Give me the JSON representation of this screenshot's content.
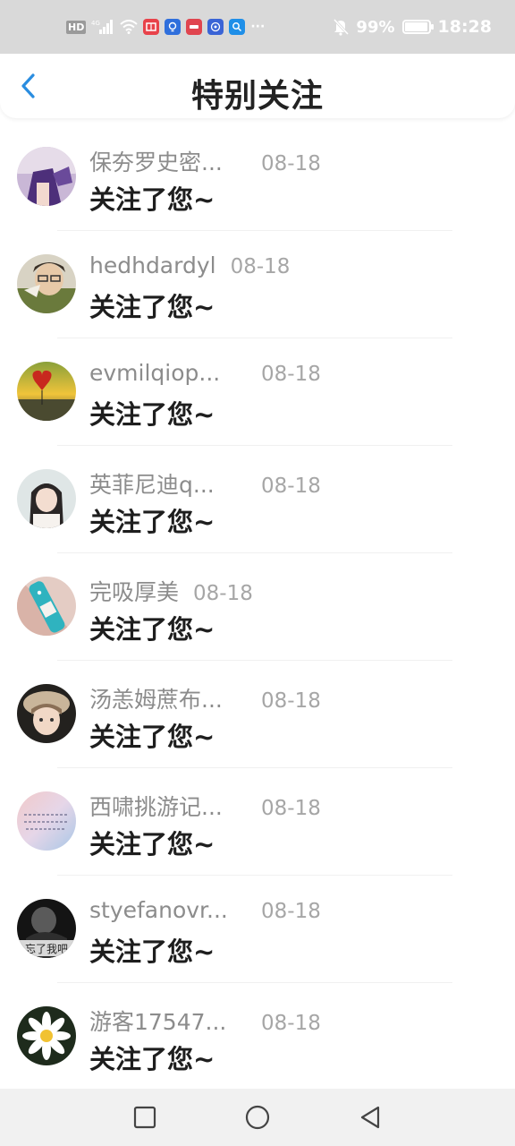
{
  "status_bar": {
    "hd_label": "HD",
    "signal_label": "4G",
    "battery_text": "99%",
    "battery_level": 0.99,
    "time": "18:28",
    "more": "···"
  },
  "header": {
    "title": "特别关注"
  },
  "follows": [
    {
      "name": "保夯罗史密...",
      "date": "08-18",
      "message": "关注了您~"
    },
    {
      "name": "hedhdardyl",
      "date": "08-18",
      "message": "关注了您~"
    },
    {
      "name": "evmilqiop...",
      "date": "08-18",
      "message": "关注了您~"
    },
    {
      "name": "英菲尼迪q...",
      "date": "08-18",
      "message": "关注了您~"
    },
    {
      "name": "完吸厚美",
      "date": "08-18",
      "message": "关注了您~"
    },
    {
      "name": "汤恙姆蔗布...",
      "date": "08-18",
      "message": "关注了您~"
    },
    {
      "name": "西啸挑游记...",
      "date": "08-18",
      "message": "关注了您~"
    },
    {
      "name": "styefanovr...",
      "date": "08-18",
      "message": "关注了您~"
    },
    {
      "name": "游客17547...",
      "date": "08-18",
      "message": "关注了您~"
    }
  ],
  "avatar_text": {
    "item_6": "忘了我吧"
  },
  "colors": {
    "accent": "#2a8de0",
    "status_bar_bg": "#d9d9d9",
    "name": "#8c8c8c",
    "date": "#a6a6a6",
    "message": "#1e1e1e"
  }
}
